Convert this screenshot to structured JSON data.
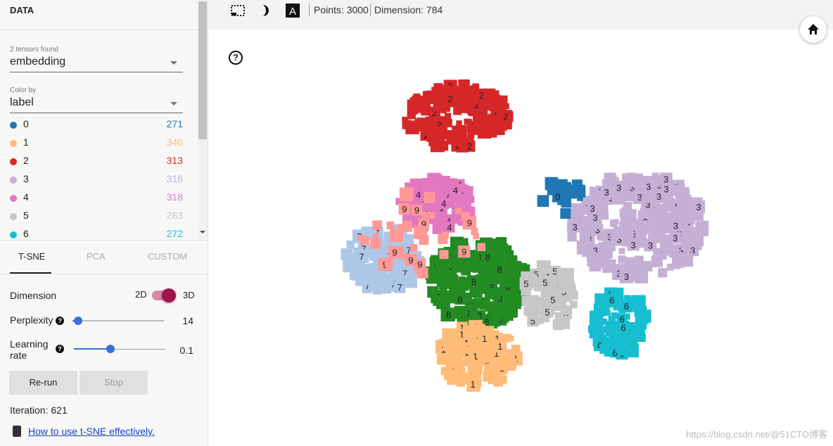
{
  "data_panel": {
    "title": "DATA",
    "tensors_label": "2 tensors found",
    "tensor_value": "embedding",
    "color_by_label": "Color by",
    "color_by_value": "label",
    "legend": [
      {
        "label": "0",
        "count": "271",
        "color": "#1f77b4"
      },
      {
        "label": "1",
        "count": "340",
        "color": "#ffbb78"
      },
      {
        "label": "2",
        "count": "313",
        "color": "#d62728"
      },
      {
        "label": "3",
        "count": "316",
        "color": "#c5b0d5"
      },
      {
        "label": "4",
        "count": "318",
        "color": "#e377c2"
      },
      {
        "label": "5",
        "count": "283",
        "color": "#c7c7c7"
      },
      {
        "label": "6",
        "count": "272",
        "color": "#17becf"
      }
    ]
  },
  "projection_tabs": [
    {
      "label": "T-SNE",
      "active": true
    },
    {
      "label": "PCA",
      "active": false
    },
    {
      "label": "CUSTOM",
      "active": false
    }
  ],
  "tsne": {
    "dimension_label": "Dimension",
    "dim_2d": "2D",
    "dim_3d": "3D",
    "dimension_selected": "3D",
    "perplexity_label": "Perplexity",
    "perplexity_value": "14",
    "perplexity_fraction": 0.06,
    "learning_rate_label_1": "Learning",
    "learning_rate_label_2": "rate",
    "learning_rate_value": "0.1",
    "learning_rate_fraction": 0.4,
    "rerun_label": "Re-run",
    "stop_label": "Stop",
    "iteration": "Iteration: 621",
    "help_link": "How to use t-SNE effectively."
  },
  "toolbar": {
    "points": "Points: 3000",
    "dimension": "Dimension: 784",
    "icons": [
      "selection-box-icon",
      "night-mode-icon",
      "label-toggle-icon"
    ]
  },
  "accent_color": "#a0154a",
  "cluster_colors": {
    "7": "#aec7e8",
    "8": "#228b22",
    "9": "#ff9896"
  },
  "watermark": "https://blog.csdn.net/@51CTO博客"
}
